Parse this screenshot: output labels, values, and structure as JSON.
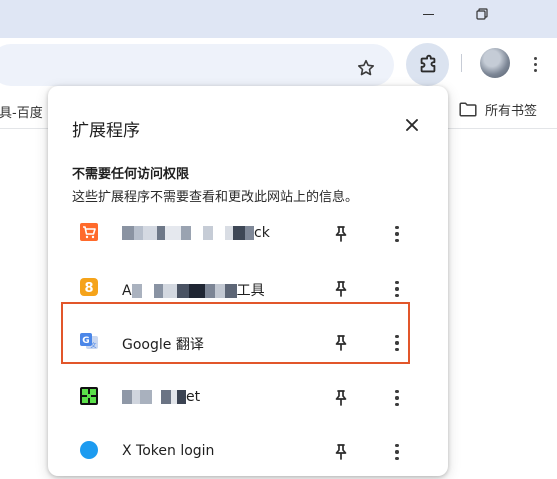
{
  "browser": {
    "bookmarks_left_text": "具-百度",
    "bookmarks_right_label": "所有书签"
  },
  "popup": {
    "title": "扩展程序",
    "section_title": "不需要任何访问权限",
    "section_desc": "这些扩展程序不需要查看和更改此网站上的信息。",
    "extensions": [
      {
        "name_visible": "ck",
        "icon": "shopping-cart-icon",
        "icon_color": "#e8501f"
      },
      {
        "name_prefix": "A",
        "name_suffix": "工具",
        "icon": "number-8-icon",
        "icon_color": "#f39c12"
      },
      {
        "name": "Google 翻译",
        "icon": "google-translate-icon",
        "icon_color": "#4285f4"
      },
      {
        "name_suffix": "et",
        "icon": "green-grid-icon",
        "icon_color": "#3fbf2a"
      },
      {
        "name": "X Token login",
        "icon": "blue-circle-icon",
        "icon_color": "#1d9bf0"
      }
    ]
  },
  "colors": {
    "titlebar": "#dfe6f4",
    "highlight_border": "#e2562a"
  }
}
